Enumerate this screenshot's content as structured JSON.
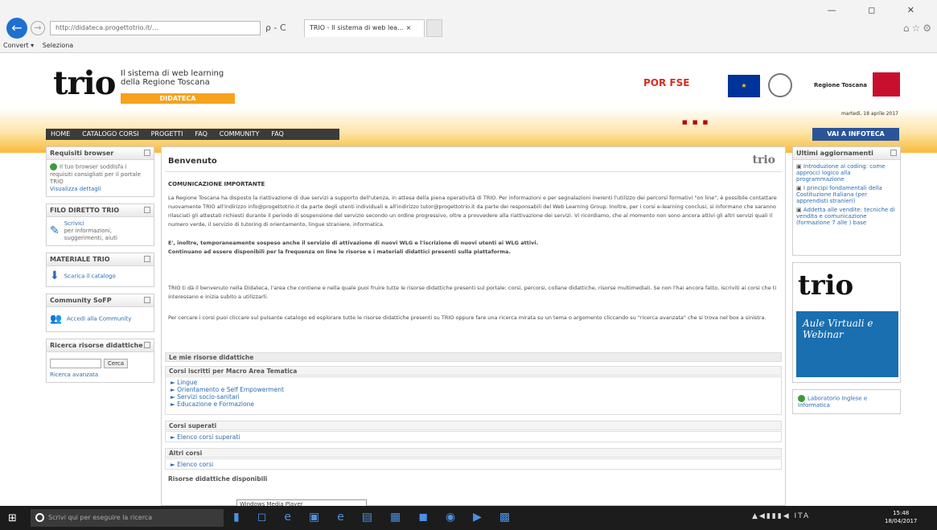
{
  "browser": {
    "address": "http://didateca.progettotrio.it/…",
    "search_reload": "ρ - C",
    "tab_label": "TRIO - Il sistema di web lea… ×",
    "favorites": [
      "Convert ▾",
      "Seleziona"
    ],
    "window_controls": "— ◻ ✕"
  },
  "header": {
    "logo": "trio",
    "subtitle_line1": "Il sistema di web learning",
    "subtitle_line2": "della Regione Toscana",
    "didateca": "DIDATECA",
    "porfse": "POR FSE",
    "regione": "Regione Toscana",
    "welcome": "martedì, 18 aprile 2017",
    "infoteca_btn": "VAI A INFOTECA",
    "menu": [
      "HOME",
      "CATALOGO CORSI",
      "PROGETTI",
      "FAQ",
      "COMMUNITY",
      "FAQ"
    ]
  },
  "left": {
    "requisiti_title": "Requisiti browser",
    "requisiti_text": "Il tuo browser soddisfa i requisiti consigliati per il portale TRIO",
    "requisiti_link": "Visualizza dettagli",
    "filo_title": "FILO DIRETTO TRIO",
    "filo_label": "Scrivici",
    "filo_text": "per informazioni, suggerimenti, aiuti",
    "materiale_title": "MATERIALE TRIO",
    "materiale_text": "Scarica il catalogo",
    "community_title": "Community SoFP",
    "community_text": "Accedi alla Community",
    "ricerca_title": "Ricerca risorse didattiche",
    "ricerca_btn": "Cerca",
    "ricerca_link": "Ricerca avanzata"
  },
  "center": {
    "title": "Benvenuto",
    "logo": "trio",
    "notice_head": "COMUNICAZIONE IMPORTANTE",
    "p1": "La Regione Toscana ha disposto la riattivazione di due servizi a supporto dell'utenza, in attesa della piena operatività di TRIO. Per informazioni e per segnalazioni inerenti l'utilizzo dei percorsi formativi \"on line\", è possibile contattare nuovamente TRIO all'indirizzo info@progettotrio.it da parte degli utenti individuali e all'indirizzo tutor@progettotrio.it da parte dei responsabili del Web Learning Group. Inoltre, per i corsi e-learning conclusi, si informano che saranno rilasciati gli attestati richiesti durante il periodo di sospensione del servizio secondo un ordine progressivo, oltre a provvedere alla riattivazione dei servizi. Vi ricordiamo, che al momento non sono ancora attivi gli altri servizi quali il numero verde, il servizio di tutoring di orientamento, lingue straniere, informatica.",
    "p2": "E', inoltre, temporaneamente sospeso anche il servizio di attivazione di nuovi WLG e l'iscrizione di nuovi utenti ai WLG attivi.",
    "p3": "Continuano ad essere disponibili per la frequenza on line le risorse e i materiali didattici presenti sulla piattaforma.",
    "p4": "TRIO ti dà il benvenuto nella Didateca, l'area che contiene e nella quale puoi fruire tutte le risorse didattiche presenti sul portale: corsi, percorsi, collane didattiche, risorse multimediali. Se non l'hai ancora fatto, iscriviti ai corsi che ti interessano e inizia subito a utilizzarli.",
    "p5": "Per cercare i corsi puoi cliccare sul pulsante catalogo ed esplorare tutte le risorse didattiche presenti su TRIO oppure fare una ricerca mirata su un tema o argomento cliccando su \"ricerca avanzata\" che si trova nel box a sinistra.",
    "mie_risorse": "Le mie risorse didattiche",
    "corsi_iscritti": "Corsi iscritti per Macro Area Tematica",
    "areas": [
      "Lingue",
      "Orientamento e Self Empowerment",
      "Servizi socio-sanitari",
      "Educazione e Formazione"
    ],
    "corsi_superati": "Corsi superati",
    "elenco_superati": "Elenco corsi superati",
    "altri_corsi": "Altri corsi",
    "elenco_corsi": "Elenco corsi",
    "risorse_disponibili": "Risorse didattiche disponibili"
  },
  "right": {
    "news_title": "Ultimi aggiornamenti",
    "news": [
      "Introduzione al coding: come approcci logico alla programmazione",
      "I principi fondamentali della Costituzione Italiana (per apprendisti stranieri)",
      "Addetta alle vendite: tecniche di vendita e comunicazione (formazione 7 alle ) base"
    ],
    "aule_logo": "trio",
    "aule_text": "Aule Virtuali e Webinar",
    "lab_text": "Laboratorio Inglese e Informatica"
  },
  "tooltip": "Windows Media Player",
  "taskbar": {
    "search_placeholder": "Scrivi qui per eseguire la ricerca",
    "tray_lang": "ITA",
    "time": "15:48",
    "date": "18/04/2017"
  }
}
